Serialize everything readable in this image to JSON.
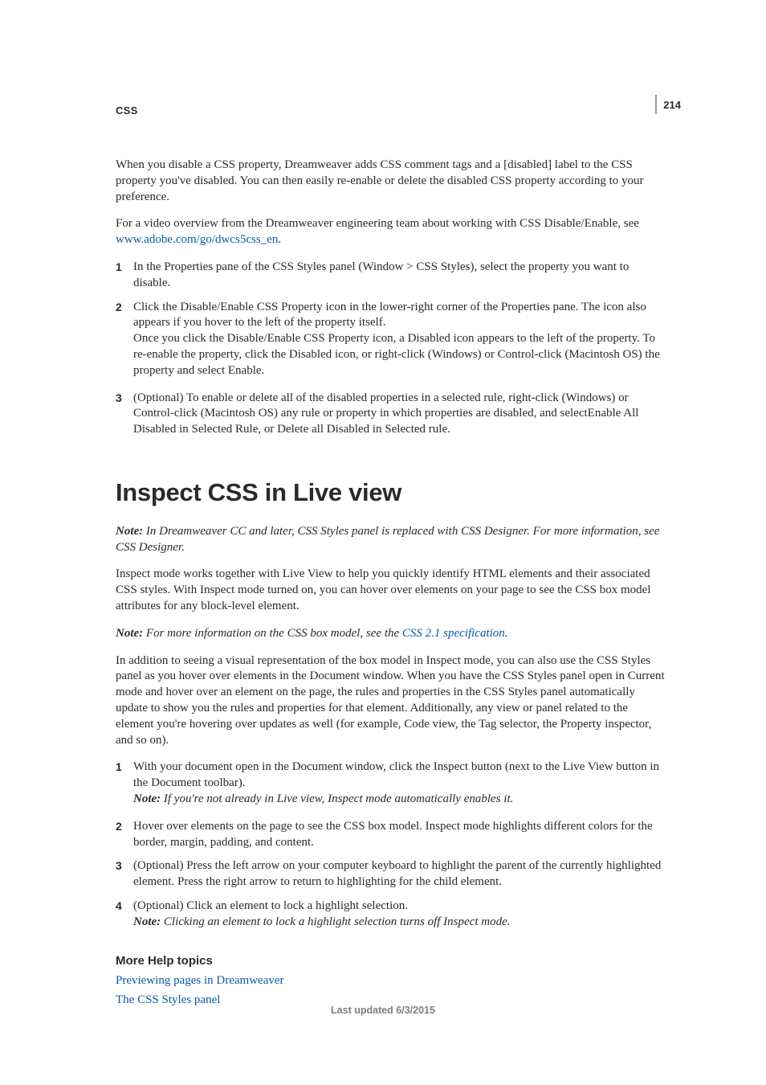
{
  "header": {
    "breadcrumb": "CSS",
    "page_number": "214"
  },
  "intro": {
    "p1": "When you disable a CSS property, Dreamweaver adds CSS comment tags and a [disabled] label to the CSS property you've disabled. You can then easily re-enable or delete the disabled CSS property according to your preference.",
    "p2_pre": "For a video overview from the Dreamweaver engineering team about working with CSS Disable/Enable, see ",
    "p2_link": "www.adobe.com/go/dwcs5css_en",
    "p2_post": "."
  },
  "steps_a": [
    {
      "text": "In the Properties pane of the CSS Styles panel (Window > CSS Styles), select the property you want to disable."
    },
    {
      "text": "Click the Disable/Enable CSS Property icon in the lower-right corner of the Properties pane. The icon also appears if you hover to the left of the property itself.",
      "body": "Once you click the Disable/Enable CSS Property icon, a Disabled icon appears to the left of the property. To re-enable the property, click the Disabled icon, or right-click (Windows) or Control-click (Macintosh OS) the property and select Enable."
    },
    {
      "text": "(Optional) To enable or delete all of the disabled properties in a selected rule, right-click (Windows) or Control-click (Macintosh OS) any rule or property in which properties are disabled, and selectEnable All Disabled in Selected Rule, or Delete all Disabled in Selected rule."
    }
  ],
  "section": {
    "title": "Inspect CSS in Live view",
    "note1_label": "Note: ",
    "note1_body": "In Dreamweaver CC and later, CSS Styles panel is replaced with CSS Designer. For more information, see CSS Designer.",
    "p1": "Inspect mode works together with Live View to help you quickly identify HTML elements and their associated CSS styles. With Inspect mode turned on, you can hover over elements on your page to see the CSS box model attributes for any block-level element.",
    "note2_label": "Note: ",
    "note2_pre": "For more information on the CSS box model, see the ",
    "note2_link": "CSS 2.1 specification",
    "note2_post": ".",
    "p2": "In addition to seeing a visual representation of the box model in Inspect mode, you can also use the CSS Styles panel as you hover over elements in the Document window. When you have the CSS Styles panel open in Current mode and hover over an element on the page, the rules and properties in the CSS Styles panel automatically update to show you the rules and properties for that element. Additionally, any view or panel related to the element you're hovering over updates as well (for example, Code view, the Tag selector, the Property inspector, and so on)."
  },
  "steps_b": [
    {
      "text": "With your document open in the Document window, click the Inspect button (next to the Live View button in the Document toolbar).",
      "note_label": "Note: ",
      "note_body": "If you're not already in Live view, Inspect mode automatically enables it."
    },
    {
      "text": "Hover over elements on the page to see the CSS box model. Inspect mode highlights different colors for the border, margin, padding, and content."
    },
    {
      "text": "(Optional) Press the left arrow on your computer keyboard to highlight the parent of the currently highlighted element. Press the right arrow to return to highlighting for the child element."
    },
    {
      "text": "(Optional) Click an element to lock a highlight selection.",
      "note_label": "Note: ",
      "note_body": "Clicking an element to lock a highlight selection turns off Inspect mode."
    }
  ],
  "more_help": {
    "heading": "More Help topics",
    "links": [
      "Previewing pages in Dreamweaver",
      "The CSS Styles panel"
    ]
  },
  "footer": {
    "last_updated": "Last updated 6/3/2015"
  }
}
